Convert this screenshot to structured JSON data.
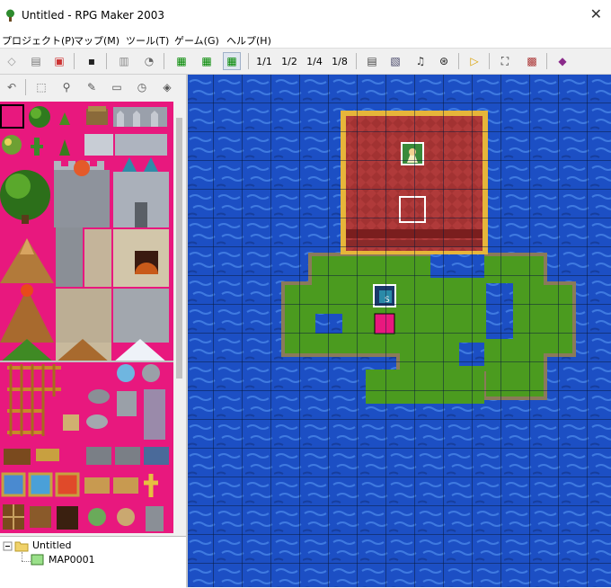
{
  "window": {
    "title": "Untitled - RPG Maker 2003"
  },
  "menu": [
    "プロジェクト(P)",
    "マップ(M)",
    "ツール(T)",
    "ゲーム(G)",
    "ヘルプ(H)"
  ],
  "toolbar": {
    "zoom_1_1": "1/1",
    "zoom_1_2": "1/2",
    "zoom_1_4": "1/4",
    "zoom_1_8": "1/8"
  },
  "tree": {
    "project": "Untitled",
    "map": "MAP0001"
  },
  "colors": {
    "water": "#1c4fc4",
    "water_light": "#3f7ae0",
    "grass": "#4a9a1e",
    "castle": "#b03a3a",
    "gold": "#e6b53a",
    "magenta": "#e8187e"
  },
  "map": {
    "hero_event_label": "S"
  }
}
